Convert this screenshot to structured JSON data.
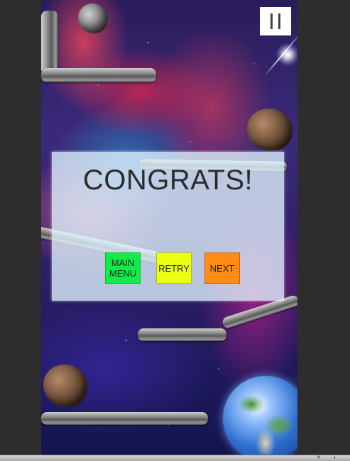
{
  "hud": {
    "pause_label": "pause"
  },
  "dialog": {
    "title": "CONGRATS!",
    "buttons": [
      {
        "label": "MAIN MENU",
        "color": "#11ec4a"
      },
      {
        "label": "RETRY",
        "color": "#eaff12"
      },
      {
        "label": "NEXT",
        "color": "#ff8a14"
      }
    ]
  },
  "colors": {
    "background": "#2d2d2d",
    "pipe": "#8d8d8d",
    "overlay": "#e1f5ff"
  },
  "icons": [
    "pause-icon",
    "asteroid-icon",
    "earth-icon",
    "sparkle-icon"
  ]
}
